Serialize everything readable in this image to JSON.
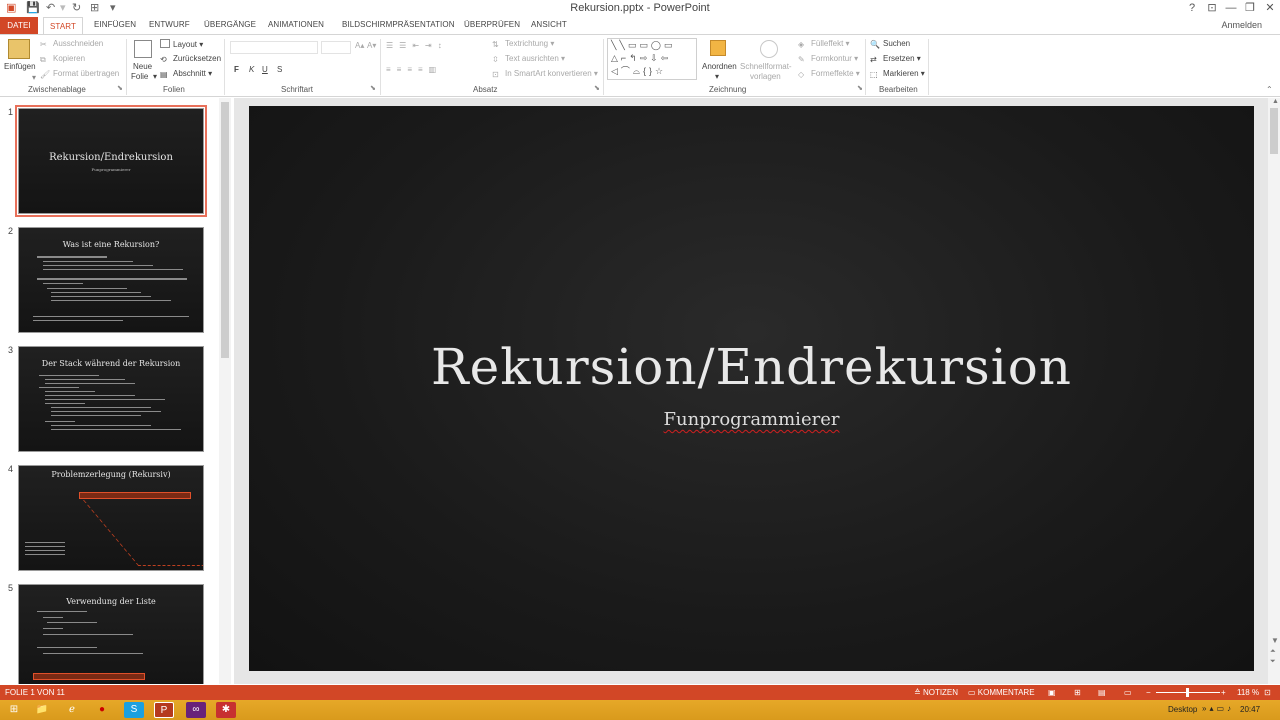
{
  "window": {
    "title": "Rekursion.pptx - PowerPoint",
    "signin": "Anmelden"
  },
  "tabs": {
    "file": "DATEI",
    "start": "START",
    "insert": "EINFÜGEN",
    "design": "ENTWURF",
    "transitions": "ÜBERGÄNGE",
    "animations": "ANIMATIONEN",
    "slideshow": "BILDSCHIRMPRÄSENTATION",
    "review": "ÜBERPRÜFEN",
    "view": "ANSICHT"
  },
  "ribbon": {
    "clipboard": {
      "paste": "Einfügen",
      "cut": "Ausschneiden",
      "copy": "Kopieren",
      "format_painter": "Format übertragen",
      "label": "Zwischenablage"
    },
    "slides": {
      "new_slide_1": "Neue",
      "new_slide_2": "Folie",
      "layout": "Layout",
      "reset": "Zurücksetzen",
      "section": "Abschnitt",
      "label": "Folien"
    },
    "font": {
      "bold": "F",
      "italic": "K",
      "underline": "U",
      "strike": "S",
      "label": "Schriftart"
    },
    "paragraph": {
      "text_direction": "Textrichtung",
      "align_text": "Text ausrichten",
      "smartart": "In SmartArt konvertieren",
      "label": "Absatz"
    },
    "drawing": {
      "arrange": "Anordnen",
      "quick_styles_1": "Schnellformat-",
      "quick_styles_2": "vorlagen",
      "fill": "Fülleffekt",
      "outline": "Formkontur",
      "effects": "Formeffekte",
      "label": "Zeichnung"
    },
    "editing": {
      "find": "Suchen",
      "replace": "Ersetzen",
      "select": "Markieren",
      "label": "Bearbeiten"
    }
  },
  "thumbnails": [
    {
      "num": "1",
      "title": "Rekursion/Endrekursion",
      "subtitle": "Funprogrammierer"
    },
    {
      "num": "2",
      "title": "Was ist eine Rekursion?"
    },
    {
      "num": "3",
      "title": "Der Stack während der Rekursion"
    },
    {
      "num": "4",
      "title": "Problemzerlegung (Rekursiv)"
    },
    {
      "num": "5",
      "title": "Verwendung der Liste"
    }
  ],
  "slide": {
    "title": "Rekursion/Endrekursion",
    "subtitle": "Funprogrammierer"
  },
  "status": {
    "slide_info": "FOLIE 1 VON 11",
    "notes": "NOTIZEN",
    "comments": "KOMMENTARE",
    "zoom": "118 %"
  },
  "taskbar": {
    "desktop": "Desktop",
    "time": "20:47"
  },
  "colors": {
    "accent": "#d24726",
    "taskbar": "#e0a020",
    "slide_bg": "#1c1c1c"
  }
}
